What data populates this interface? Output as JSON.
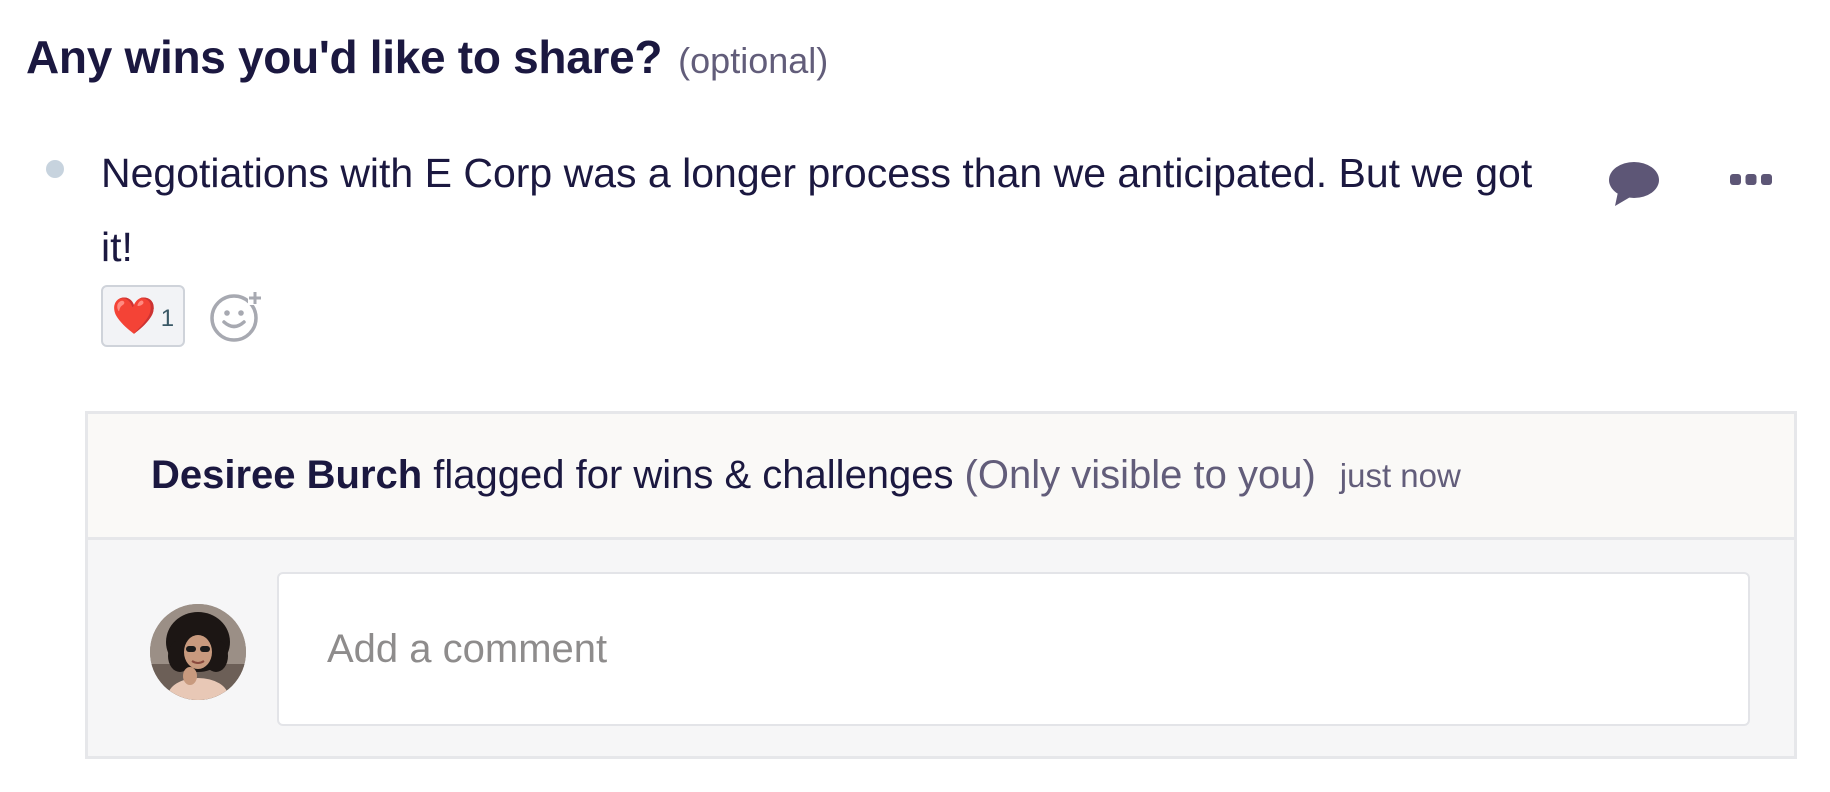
{
  "question": {
    "title": "Any wins you'd like to share?",
    "optional_label": "(optional)"
  },
  "answer": {
    "text": "Negotiations with E Corp was a longer process than we anticipated. But we got it!",
    "reactions": [
      {
        "emoji": "❤️",
        "count": "1"
      }
    ],
    "actions": {
      "comment_icon": "speech-bubble-icon",
      "more_icon": "ellipsis-icon",
      "add_reaction_icon": "add-emoji-icon"
    }
  },
  "flag": {
    "user_name": "Desiree Burch",
    "action_text": "flagged for wins & challenges",
    "visibility_note": "(Only visible to you)",
    "timestamp": "just now"
  },
  "comment": {
    "placeholder": "Add a comment"
  },
  "colors": {
    "text_primary": "#1b1840",
    "text_muted": "#625d7a",
    "icon": "#5d5676",
    "bullet": "#c7d3de",
    "panel_bg": "#f6f6f7",
    "panel_header_bg": "#faf9f7",
    "border": "#e6e7ea"
  }
}
